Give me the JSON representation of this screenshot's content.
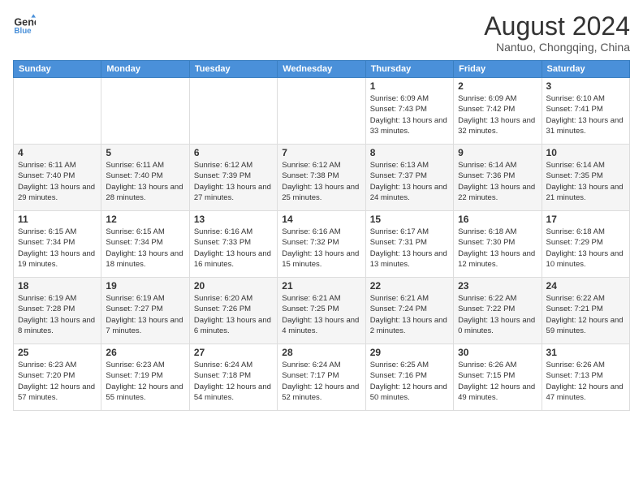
{
  "header": {
    "logo_line1": "General",
    "logo_line2": "Blue",
    "month_year": "August 2024",
    "location": "Nantuo, Chongqing, China"
  },
  "weekdays": [
    "Sunday",
    "Monday",
    "Tuesday",
    "Wednesday",
    "Thursday",
    "Friday",
    "Saturday"
  ],
  "weeks": [
    [
      {
        "day": "",
        "info": ""
      },
      {
        "day": "",
        "info": ""
      },
      {
        "day": "",
        "info": ""
      },
      {
        "day": "",
        "info": ""
      },
      {
        "day": "1",
        "info": "Sunrise: 6:09 AM\nSunset: 7:43 PM\nDaylight: 13 hours\nand 33 minutes."
      },
      {
        "day": "2",
        "info": "Sunrise: 6:09 AM\nSunset: 7:42 PM\nDaylight: 13 hours\nand 32 minutes."
      },
      {
        "day": "3",
        "info": "Sunrise: 6:10 AM\nSunset: 7:41 PM\nDaylight: 13 hours\nand 31 minutes."
      }
    ],
    [
      {
        "day": "4",
        "info": "Sunrise: 6:11 AM\nSunset: 7:40 PM\nDaylight: 13 hours\nand 29 minutes."
      },
      {
        "day": "5",
        "info": "Sunrise: 6:11 AM\nSunset: 7:40 PM\nDaylight: 13 hours\nand 28 minutes."
      },
      {
        "day": "6",
        "info": "Sunrise: 6:12 AM\nSunset: 7:39 PM\nDaylight: 13 hours\nand 27 minutes."
      },
      {
        "day": "7",
        "info": "Sunrise: 6:12 AM\nSunset: 7:38 PM\nDaylight: 13 hours\nand 25 minutes."
      },
      {
        "day": "8",
        "info": "Sunrise: 6:13 AM\nSunset: 7:37 PM\nDaylight: 13 hours\nand 24 minutes."
      },
      {
        "day": "9",
        "info": "Sunrise: 6:14 AM\nSunset: 7:36 PM\nDaylight: 13 hours\nand 22 minutes."
      },
      {
        "day": "10",
        "info": "Sunrise: 6:14 AM\nSunset: 7:35 PM\nDaylight: 13 hours\nand 21 minutes."
      }
    ],
    [
      {
        "day": "11",
        "info": "Sunrise: 6:15 AM\nSunset: 7:34 PM\nDaylight: 13 hours\nand 19 minutes."
      },
      {
        "day": "12",
        "info": "Sunrise: 6:15 AM\nSunset: 7:34 PM\nDaylight: 13 hours\nand 18 minutes."
      },
      {
        "day": "13",
        "info": "Sunrise: 6:16 AM\nSunset: 7:33 PM\nDaylight: 13 hours\nand 16 minutes."
      },
      {
        "day": "14",
        "info": "Sunrise: 6:16 AM\nSunset: 7:32 PM\nDaylight: 13 hours\nand 15 minutes."
      },
      {
        "day": "15",
        "info": "Sunrise: 6:17 AM\nSunset: 7:31 PM\nDaylight: 13 hours\nand 13 minutes."
      },
      {
        "day": "16",
        "info": "Sunrise: 6:18 AM\nSunset: 7:30 PM\nDaylight: 13 hours\nand 12 minutes."
      },
      {
        "day": "17",
        "info": "Sunrise: 6:18 AM\nSunset: 7:29 PM\nDaylight: 13 hours\nand 10 minutes."
      }
    ],
    [
      {
        "day": "18",
        "info": "Sunrise: 6:19 AM\nSunset: 7:28 PM\nDaylight: 13 hours\nand 8 minutes."
      },
      {
        "day": "19",
        "info": "Sunrise: 6:19 AM\nSunset: 7:27 PM\nDaylight: 13 hours\nand 7 minutes."
      },
      {
        "day": "20",
        "info": "Sunrise: 6:20 AM\nSunset: 7:26 PM\nDaylight: 13 hours\nand 6 minutes."
      },
      {
        "day": "21",
        "info": "Sunrise: 6:21 AM\nSunset: 7:25 PM\nDaylight: 13 hours\nand 4 minutes."
      },
      {
        "day": "22",
        "info": "Sunrise: 6:21 AM\nSunset: 7:24 PM\nDaylight: 13 hours\nand 2 minutes."
      },
      {
        "day": "23",
        "info": "Sunrise: 6:22 AM\nSunset: 7:22 PM\nDaylight: 13 hours\nand 0 minutes."
      },
      {
        "day": "24",
        "info": "Sunrise: 6:22 AM\nSunset: 7:21 PM\nDaylight: 12 hours\nand 59 minutes."
      }
    ],
    [
      {
        "day": "25",
        "info": "Sunrise: 6:23 AM\nSunset: 7:20 PM\nDaylight: 12 hours\nand 57 minutes."
      },
      {
        "day": "26",
        "info": "Sunrise: 6:23 AM\nSunset: 7:19 PM\nDaylight: 12 hours\nand 55 minutes."
      },
      {
        "day": "27",
        "info": "Sunrise: 6:24 AM\nSunset: 7:18 PM\nDaylight: 12 hours\nand 54 minutes."
      },
      {
        "day": "28",
        "info": "Sunrise: 6:24 AM\nSunset: 7:17 PM\nDaylight: 12 hours\nand 52 minutes."
      },
      {
        "day": "29",
        "info": "Sunrise: 6:25 AM\nSunset: 7:16 PM\nDaylight: 12 hours\nand 50 minutes."
      },
      {
        "day": "30",
        "info": "Sunrise: 6:26 AM\nSunset: 7:15 PM\nDaylight: 12 hours\nand 49 minutes."
      },
      {
        "day": "31",
        "info": "Sunrise: 6:26 AM\nSunset: 7:13 PM\nDaylight: 12 hours\nand 47 minutes."
      }
    ]
  ]
}
